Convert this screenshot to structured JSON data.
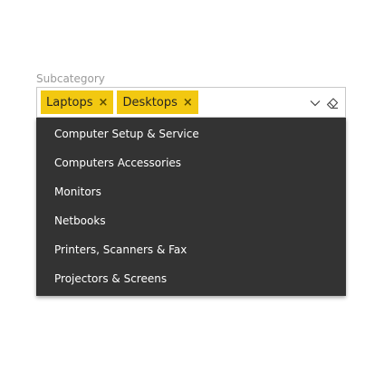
{
  "filter": {
    "label": "Subcategory",
    "selected_chips": [
      {
        "label": "Laptops",
        "remove_glyph": "×"
      },
      {
        "label": "Desktops",
        "remove_glyph": "×"
      }
    ],
    "icons": {
      "chevron": "chevron-down-icon",
      "clear": "eraser-icon"
    },
    "colors": {
      "chip_background": "#f2c811",
      "dropdown_background": "#333333",
      "option_text": "#ffffff"
    }
  },
  "dropdown": {
    "options": [
      {
        "label": "Computer Setup & Service"
      },
      {
        "label": "Computers Accessories"
      },
      {
        "label": "Monitors"
      },
      {
        "label": "Netbooks"
      },
      {
        "label": "Printers, Scanners & Fax"
      },
      {
        "label": "Projectors & Screens"
      }
    ]
  }
}
